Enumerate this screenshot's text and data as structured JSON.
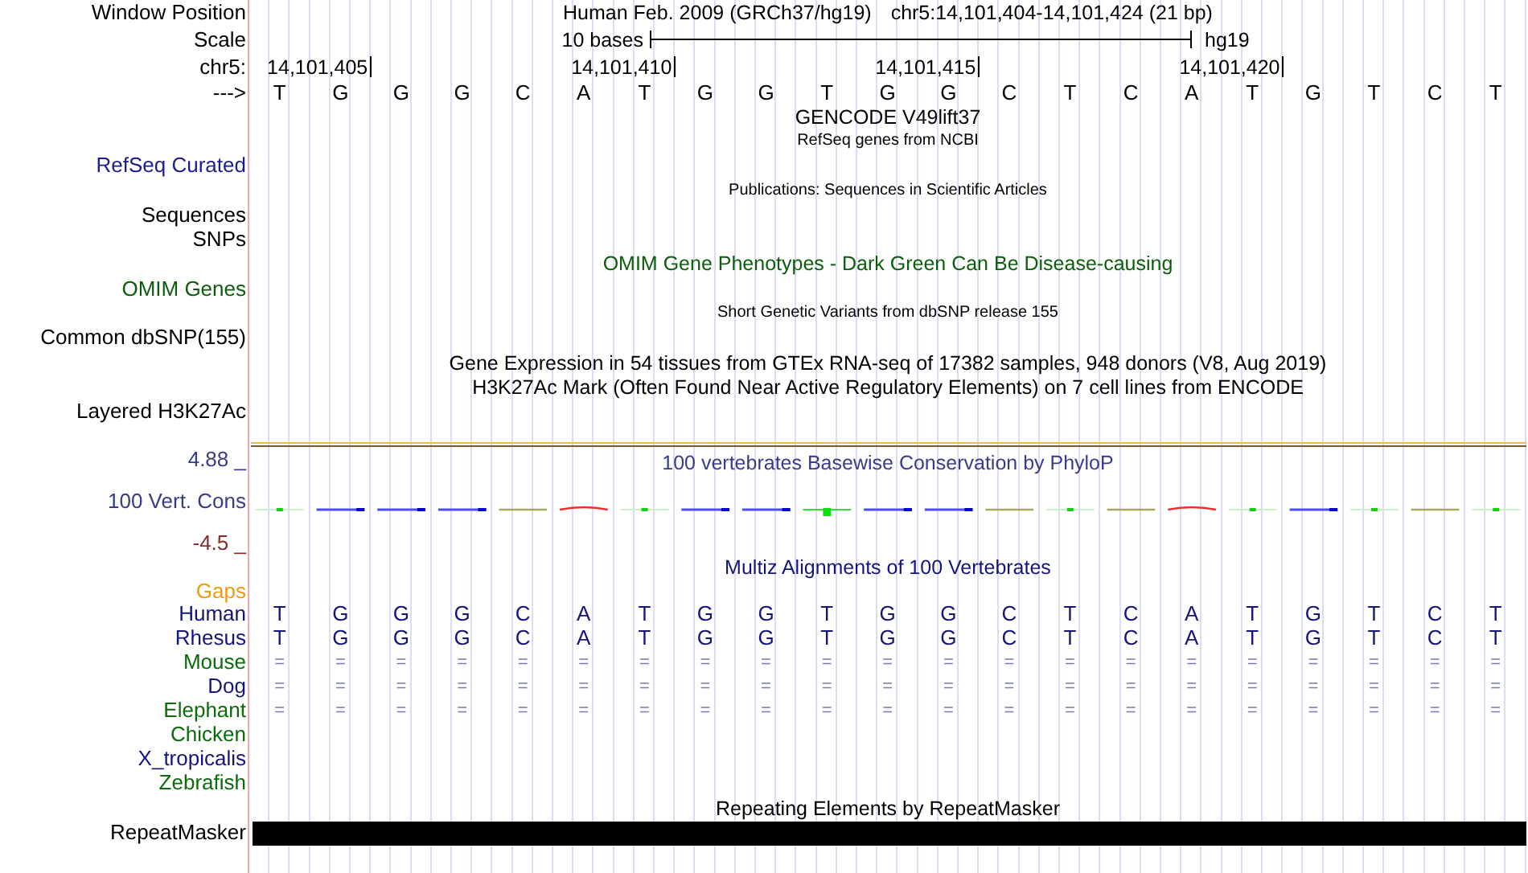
{
  "header": {
    "label": "Window Position",
    "assembly": "Human Feb. 2009 (GRCh37/hg19)",
    "position": "chr5:14,101,404-14,101,424 (21 bp)"
  },
  "scale": {
    "label": "Scale",
    "text": "10 bases",
    "assembly": "hg19"
  },
  "ruler": {
    "label": "chr5:",
    "ticks": [
      "14,101,405",
      "14,101,410",
      "14,101,415",
      "14,101,420"
    ]
  },
  "sequence": {
    "label": "--->",
    "bases": [
      "T",
      "G",
      "G",
      "G",
      "C",
      "A",
      "T",
      "G",
      "G",
      "T",
      "G",
      "G",
      "C",
      "T",
      "C",
      "A",
      "T",
      "G",
      "T",
      "C",
      "T"
    ]
  },
  "tracks": [
    {
      "kind": "title",
      "text": "GENCODE V49lift37",
      "color": "#000000"
    },
    {
      "kind": "subtitle",
      "text": "RefSeq genes from NCBI",
      "color": "#000000"
    },
    {
      "kind": "label",
      "text": "RefSeq Curated",
      "color": "#1c1c8c"
    },
    {
      "kind": "subtitle",
      "text": "Publications: Sequences in Scientific Articles",
      "color": "#000000"
    },
    {
      "kind": "label",
      "text": "Sequences",
      "color": "#000000"
    },
    {
      "kind": "label",
      "text": "SNPs",
      "color": "#000000"
    },
    {
      "kind": "title",
      "text": "OMIM Gene Phenotypes - Dark Green Can Be Disease-causing",
      "color": "#0b5d0b"
    },
    {
      "kind": "label",
      "text": "OMIM Genes",
      "color": "#0b5d0b"
    },
    {
      "kind": "subtitle",
      "text": "Short Genetic Variants from dbSNP release 155",
      "color": "#000000"
    },
    {
      "kind": "label",
      "text": "Common dbSNP(155)",
      "color": "#000000"
    },
    {
      "kind": "title",
      "text": "Gene Expression in 54 tissues from GTEx RNA-seq of 17382 samples, 948 donors (V8, Aug 2019)",
      "color": "#000000"
    },
    {
      "kind": "title",
      "text": "H3K27Ac Mark (Often Found Near Active Regulatory Elements) on 7 cell lines from ENCODE",
      "color": "#000000"
    },
    {
      "kind": "label",
      "text": "Layered H3K27Ac",
      "color": "#000000"
    }
  ],
  "conservation": {
    "max": "4.88 _",
    "label": "100 Vert. Cons",
    "min": "-4.5 _",
    "title": "100 vertebrates Basewise Conservation by PhyloP"
  },
  "alignment": {
    "title": "Multiz Alignments of 100 Vertebrates",
    "gaps_label": "Gaps",
    "species": [
      {
        "name": "Human",
        "color": "#14147a",
        "kind": "bases",
        "cells": [
          "T",
          "G",
          "G",
          "G",
          "C",
          "A",
          "T",
          "G",
          "G",
          "T",
          "G",
          "G",
          "C",
          "T",
          "C",
          "A",
          "T",
          "G",
          "T",
          "C",
          "T"
        ]
      },
      {
        "name": "Rhesus",
        "color": "#14147a",
        "kind": "bases",
        "cells": [
          "T",
          "G",
          "G",
          "G",
          "C",
          "A",
          "T",
          "G",
          "G",
          "T",
          "G",
          "G",
          "C",
          "T",
          "C",
          "A",
          "T",
          "G",
          "T",
          "C",
          "T"
        ]
      },
      {
        "name": "Mouse",
        "color": "#0b6b0b",
        "kind": "matches",
        "cells": [
          "=",
          "=",
          "=",
          "=",
          "=",
          "=",
          "=",
          "=",
          "=",
          "=",
          "=",
          "=",
          "=",
          "=",
          "=",
          "=",
          "=",
          "=",
          "=",
          "=",
          "="
        ]
      },
      {
        "name": "Dog",
        "color": "#14147a",
        "kind": "matches",
        "cells": [
          "=",
          "=",
          "=",
          "=",
          "=",
          "=",
          "=",
          "=",
          "=",
          "=",
          "=",
          "=",
          "=",
          "=",
          "=",
          "=",
          "=",
          "=",
          "=",
          "=",
          "="
        ]
      },
      {
        "name": "Elephant",
        "color": "#0b6b0b",
        "kind": "matches",
        "cells": [
          "=",
          "=",
          "=",
          "=",
          "=",
          "=",
          "=",
          "=",
          "=",
          "=",
          "=",
          "=",
          "=",
          "=",
          "=",
          "=",
          "=",
          "=",
          "=",
          "=",
          "="
        ]
      },
      {
        "name": "Chicken",
        "color": "#0b6b0b",
        "kind": "empty"
      },
      {
        "name": "X_tropicalis",
        "color": "#14147a",
        "kind": "empty"
      },
      {
        "name": "Zebrafish",
        "color": "#0b6b0b",
        "kind": "empty"
      }
    ]
  },
  "repeats": {
    "title": "Repeating Elements by RepeatMasker",
    "label": "RepeatMasker"
  }
}
